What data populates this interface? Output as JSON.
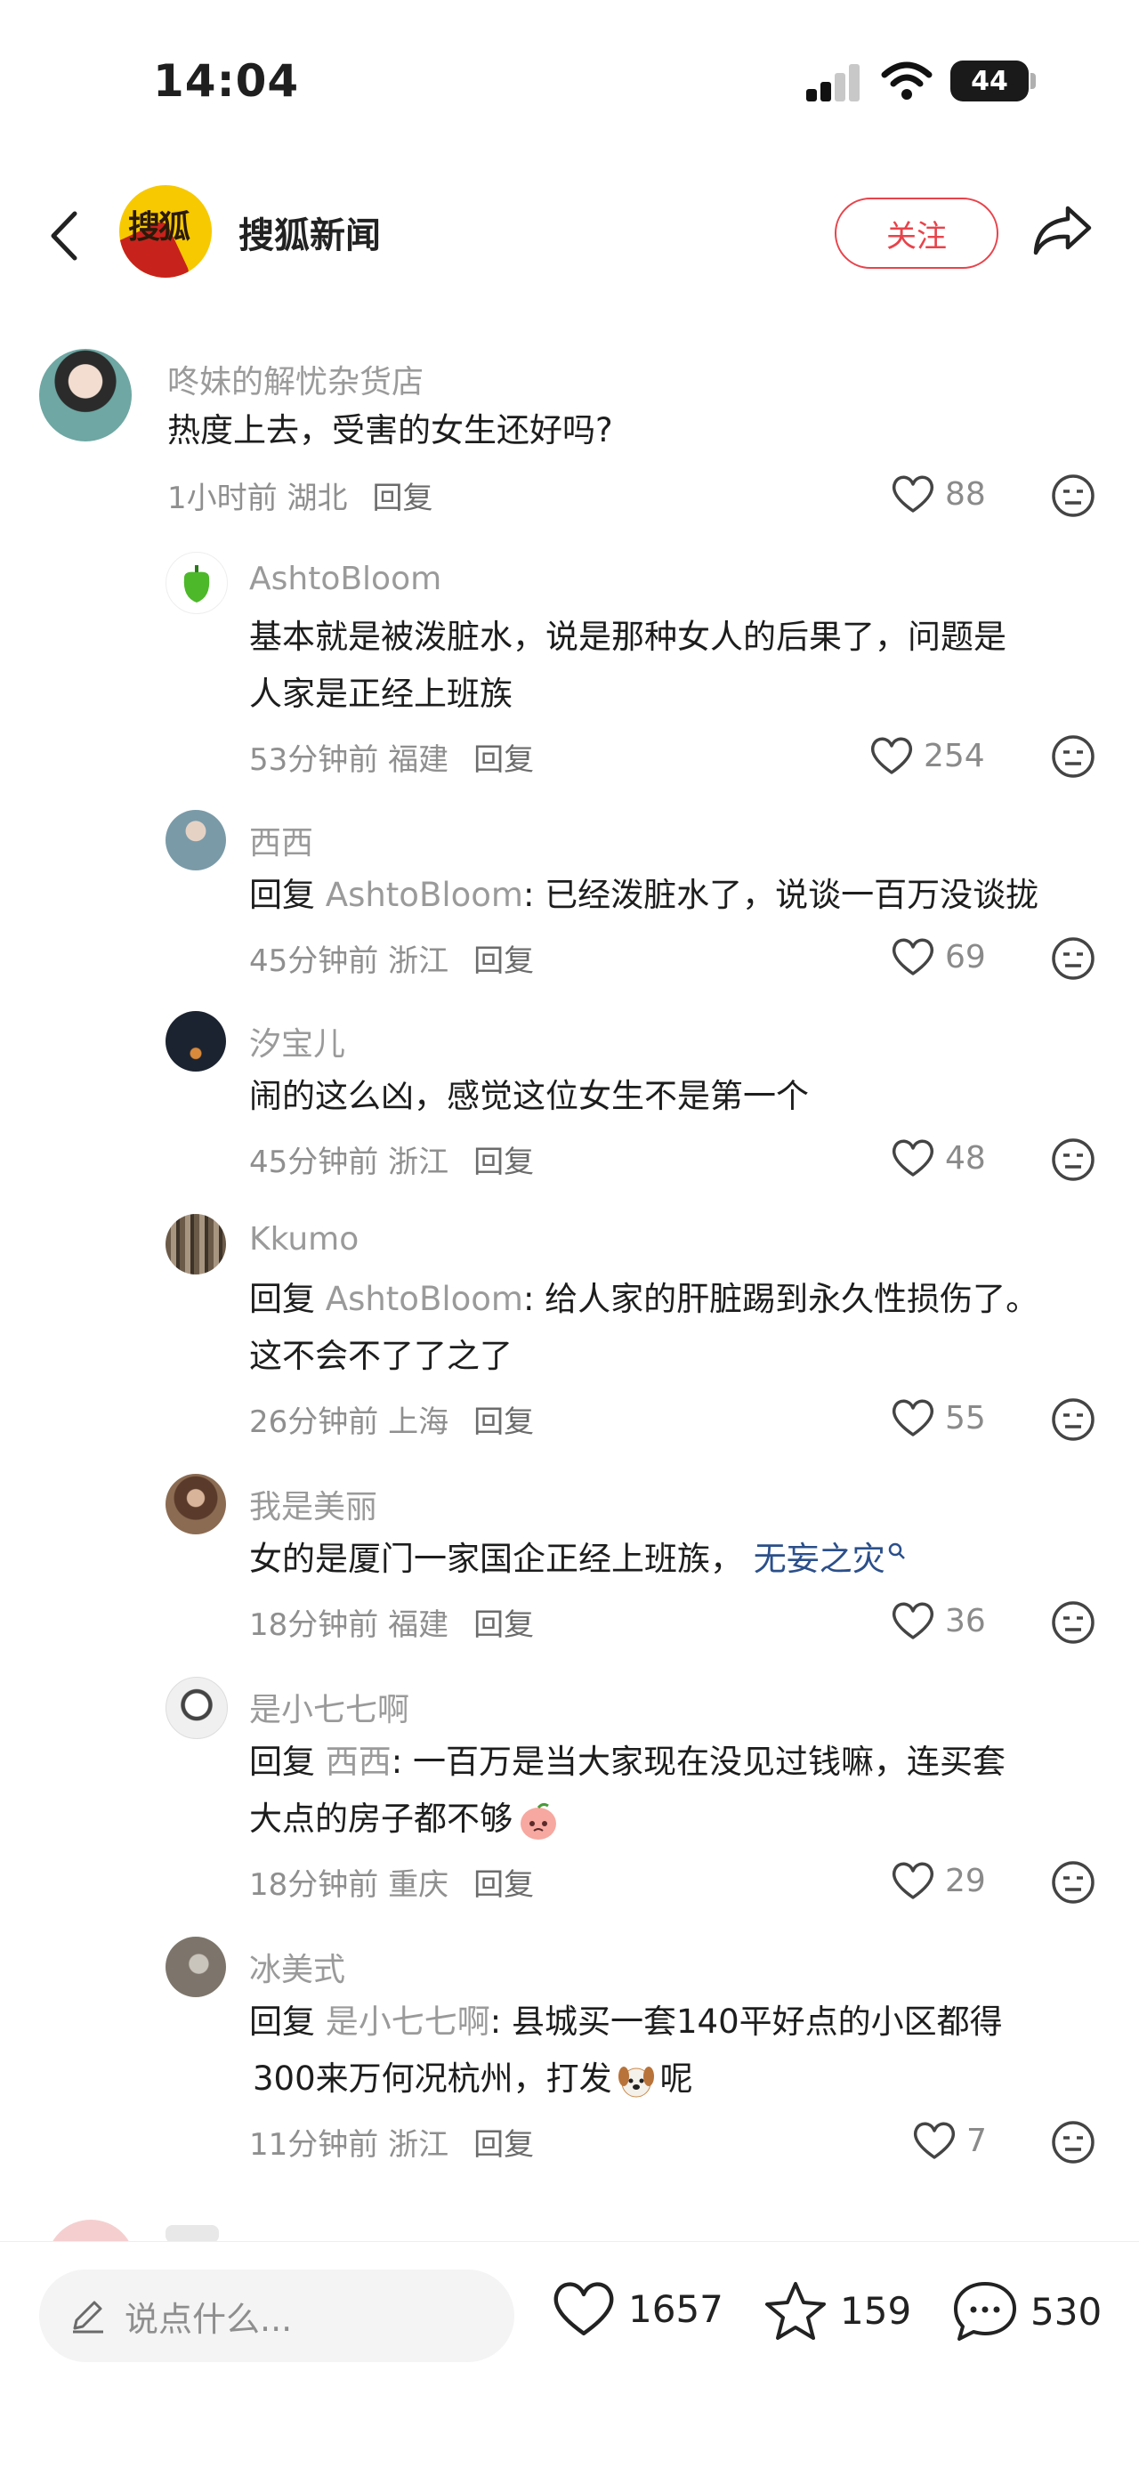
{
  "status_bar": {
    "time": "14:04",
    "battery": "44"
  },
  "header": {
    "logo_text": "搜狐",
    "account_name": "搜狐新闻",
    "follow_label": "关注"
  },
  "comments": [
    {
      "username": "咚妹的解忧杂货店",
      "text": "热度上去，受害的女生还好吗?",
      "time": "1小时前",
      "location": "湖北",
      "reply_label": "回复",
      "likes": "88"
    },
    {
      "username": "AshtoBloom",
      "text_lines": [
        "基本就是被泼脏水，说是那种女人的后果了，问题是",
        "人家是正经上班族"
      ],
      "time": "53分钟前",
      "location": "福建",
      "reply_label": "回复",
      "likes": "254"
    },
    {
      "username": "西西",
      "reply_prefix": "回复",
      "reply_to": "AshtoBloom",
      "text": ": 已经泼脏水了，说谈一百万没谈拢",
      "time": "45分钟前",
      "location": "浙江",
      "reply_label": "回复",
      "likes": "69"
    },
    {
      "username": "汐宝儿",
      "text": "闹的这么凶，感觉这位女生不是第一个",
      "time": "45分钟前",
      "location": "浙江",
      "reply_label": "回复",
      "likes": "48"
    },
    {
      "username": "Kkumo",
      "reply_prefix": "回复",
      "reply_to": "AshtoBloom",
      "text": ": 给人家的肝脏踢到永久性损伤了。",
      "text_line2": "这不会不了了之了",
      "time": "26分钟前",
      "location": "上海",
      "reply_label": "回复",
      "likes": "55"
    },
    {
      "username": "我是美丽",
      "text": "女的是厦门一家国企正经上班族，",
      "link_text": "无妄之灾",
      "time": "18分钟前",
      "location": "福建",
      "reply_label": "回复",
      "likes": "36"
    },
    {
      "username": "是小七七啊",
      "reply_prefix": "回复",
      "reply_to": "西西",
      "text": ": 一百万是当大家现在没见过钱嘛，连买套",
      "text_line2": "大点的房子都不够",
      "time": "18分钟前",
      "location": "重庆",
      "reply_label": "回复",
      "likes": "29"
    },
    {
      "username": "冰美式",
      "reply_prefix": "回复",
      "reply_to": "是小七七啊",
      "text": ": 县城买一套140平好点的小区都得",
      "text_line2a": "300来万何况杭州，打发",
      "text_line2b": "呢",
      "time": "11分钟前",
      "location": "浙江",
      "reply_label": "回复",
      "likes": "7"
    }
  ],
  "bottom_bar": {
    "placeholder": "说点什么...",
    "likes": "1657",
    "favorites": "159",
    "comments": "530"
  }
}
